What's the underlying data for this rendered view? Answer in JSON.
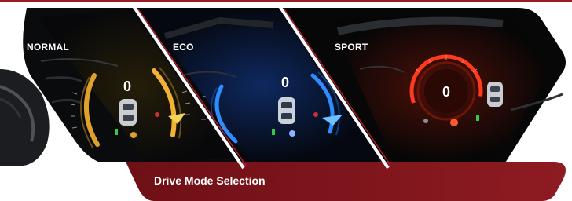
{
  "banner": {
    "caption": "Drive Mode Selection",
    "accent_color": "#9b1b24",
    "modes": [
      {
        "label": "NORMAL",
        "gauge_color": "#f2b233",
        "display_value": "0"
      },
      {
        "label": "ECO",
        "gauge_color": "#2f8cff",
        "display_value": "0"
      },
      {
        "label": "SPORT",
        "gauge_color": "#ff3a1f",
        "display_value": "0"
      }
    ]
  }
}
